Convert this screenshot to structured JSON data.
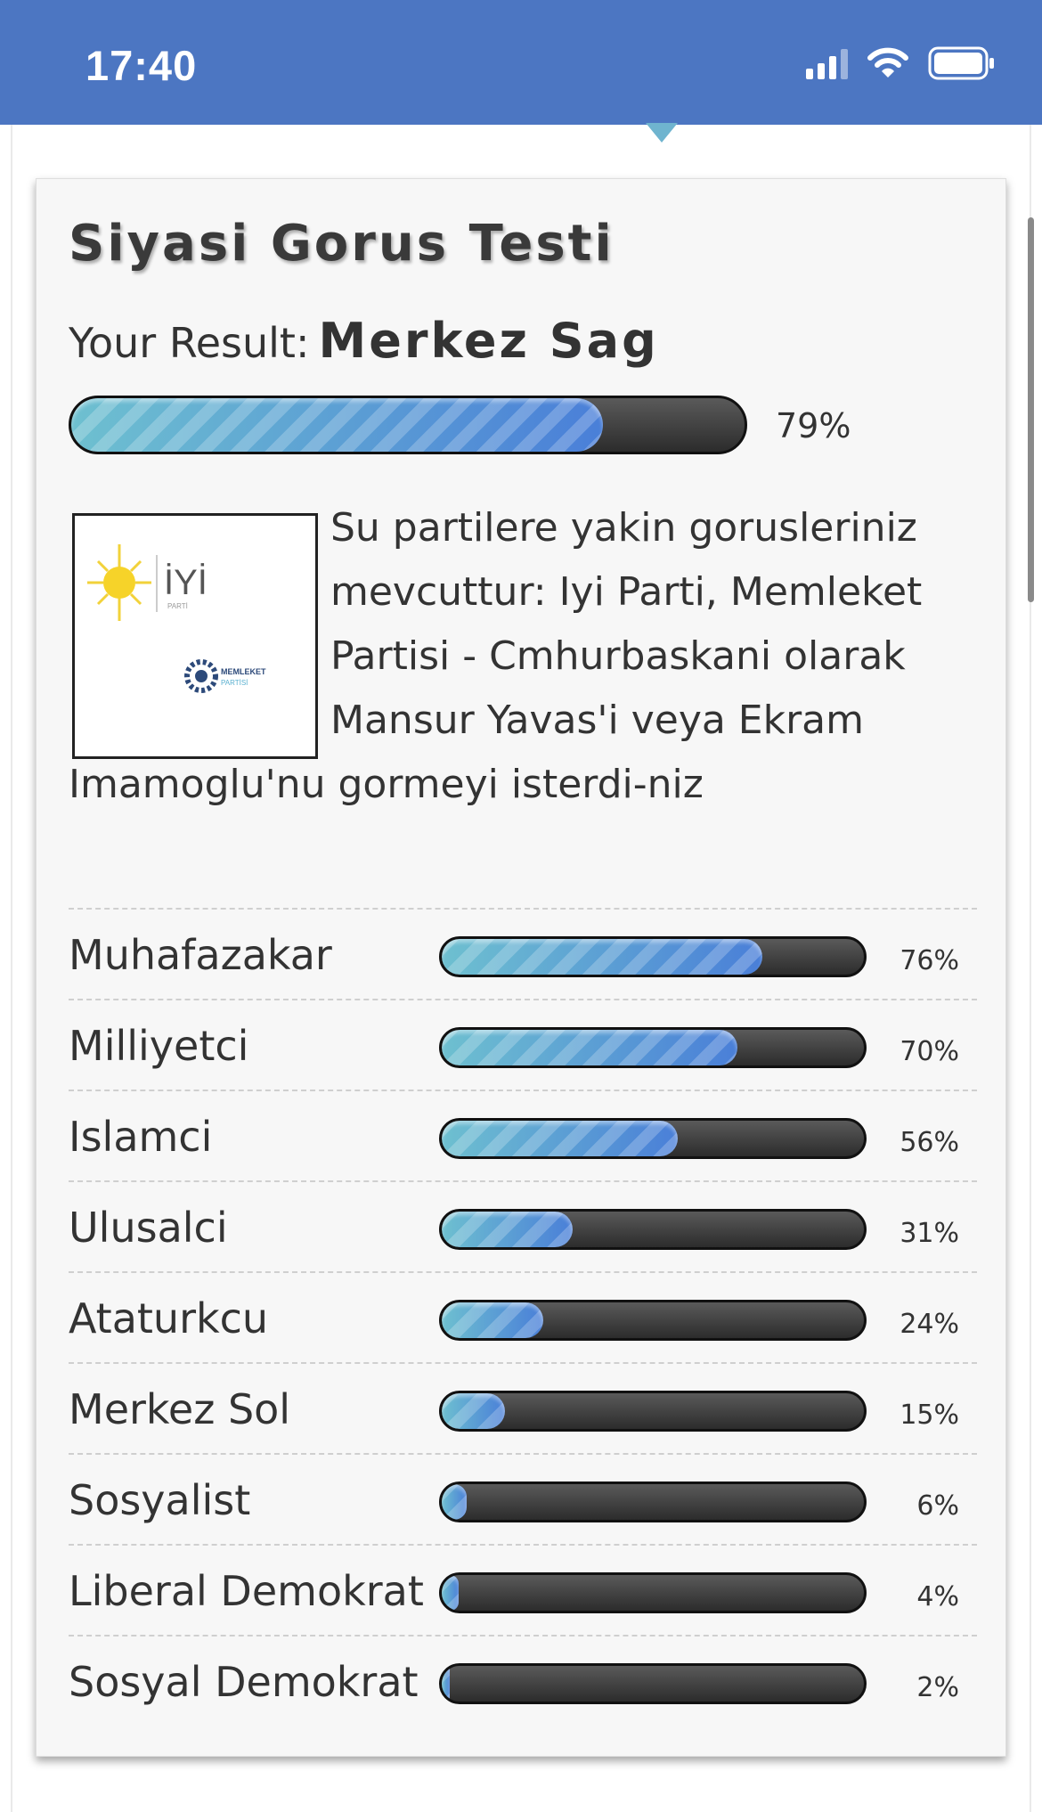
{
  "status_bar": {
    "time": "17:40"
  },
  "quiz": {
    "title": "Siyasi Gorus Testi",
    "result_prefix": "Your Result:",
    "result_value": "Merkez Sag",
    "result_percent": 79,
    "result_percent_label": "79%",
    "logo": {
      "brand1": "İYİ",
      "brand1_sub": "PARTİ",
      "brand2": "MEMLEKET",
      "brand2_sub": "PARTİSİ"
    },
    "description": "Su partilere yakin gorusleriniz mevcuttur: Iyi Parti, Memleket Partisi - Cmhurbaskani olarak Mansur Yavas'i veya Ekram Imamoglu'nu gormeyi isterdi-niz",
    "scores": [
      {
        "label": "Muhafazakar",
        "percent": 76,
        "percent_label": "76%"
      },
      {
        "label": "Milliyetci",
        "percent": 70,
        "percent_label": "70%"
      },
      {
        "label": "Islamci",
        "percent": 56,
        "percent_label": "56%"
      },
      {
        "label": "Ulusalci",
        "percent": 31,
        "percent_label": "31%"
      },
      {
        "label": "Ataturkcu",
        "percent": 24,
        "percent_label": "24%"
      },
      {
        "label": "Merkez Sol",
        "percent": 15,
        "percent_label": "15%"
      },
      {
        "label": "Sosyalist",
        "percent": 6,
        "percent_label": "6%"
      },
      {
        "label": "Liberal Demokrat",
        "percent": 4,
        "percent_label": "4%"
      },
      {
        "label": "Sosyal Demokrat",
        "percent": 2,
        "percent_label": "2%"
      }
    ]
  },
  "colors": {
    "status_bar": "#4c76c2",
    "bar_fill_start": "#6ec0d0",
    "bar_fill_end": "#4a7fd8",
    "bar_track": "#333333"
  }
}
